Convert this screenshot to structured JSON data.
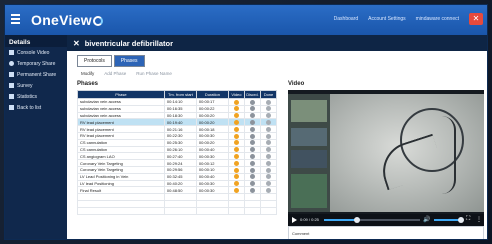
{
  "app": {
    "logo_text": "OneView",
    "menu_icon": "hamburger-icon"
  },
  "topbar": {
    "links": [
      "Dashboard",
      "Account Settings",
      "mindaware connect"
    ],
    "close_icon": "close-icon"
  },
  "sidebar": {
    "header": "Details",
    "items": [
      {
        "label": "Console Video",
        "icon": "video-icon"
      },
      {
        "label": "Temporary Share",
        "icon": "clock-icon"
      },
      {
        "label": "Permanent Share",
        "icon": "share-icon"
      },
      {
        "label": "Survey",
        "icon": "survey-icon"
      },
      {
        "label": "Statistics",
        "icon": "chart-icon"
      },
      {
        "label": "Back to list",
        "icon": "back-arrow-icon"
      }
    ]
  },
  "main": {
    "title": "biventricular defibrillator",
    "tabs": [
      "Protocols",
      "Phases"
    ],
    "active_tab": "Phases",
    "subnav": [
      "Modify",
      "Add Phase",
      "Run Phase Name"
    ],
    "phases_label": "Phases",
    "video_label": "Video"
  },
  "phase_table": {
    "headers": [
      "Phase",
      "Tm. from start",
      "Duration",
      "Video",
      "Discrd.",
      "Done"
    ],
    "rows": [
      [
        "subclavian vein access",
        "00:14:10",
        "00:00:17"
      ],
      [
        "subclavian vein access",
        "00:16:35",
        "00:00:22"
      ],
      [
        "subclavian vein access",
        "00:18:30",
        "00:00:20"
      ],
      [
        "RV lead placement",
        "00:19:40",
        "00:00:20"
      ],
      [
        "RV lead placement",
        "00:21:16",
        "00:00:18"
      ],
      [
        "RV lead placement",
        "00:22:30",
        "00:00:30"
      ],
      [
        "CS cannulation",
        "00:25:30",
        "00:00:20"
      ],
      [
        "CS cannulation",
        "00:26:10",
        "00:00:40"
      ],
      [
        "CS angiogram LAO",
        "00:27:40",
        "00:00:30"
      ],
      [
        "Coronary Vein Targeting",
        "00:29:24",
        "00:00:12"
      ],
      [
        "Coronary Vein Targeting",
        "00:29:56",
        "00:00:10"
      ],
      [
        "LV Lead Positioning in Vein",
        "00:32:45",
        "00:00:40"
      ],
      [
        "LV lead Positioning",
        "00:40:20",
        "00:00:30"
      ],
      [
        "Final Result",
        "00:48:50",
        "00:00:30"
      ]
    ],
    "selected_row": 3
  },
  "video": {
    "timecode": "0:09 / 0:25",
    "play_icon": "play-icon",
    "volume_icon": "volume-icon",
    "fullscreen_icon": "fullscreen-icon",
    "more_icon": "more-options-icon",
    "progress": 0.34,
    "comment_label": "Comment"
  }
}
